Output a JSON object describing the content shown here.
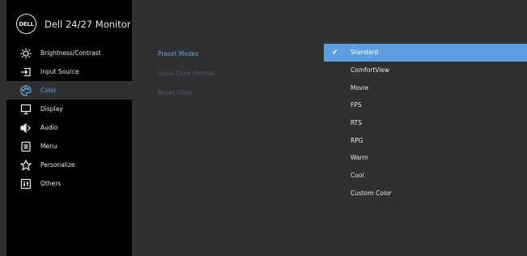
{
  "header": {
    "logo_text": "DELL",
    "title": "Dell 24/27 Monitor"
  },
  "sidebar": {
    "items": [
      {
        "label": "Brightness/Contrast",
        "icon": "brightness-icon"
      },
      {
        "label": "Input Source",
        "icon": "input-source-icon"
      },
      {
        "label": "Color",
        "icon": "color-palette-icon"
      },
      {
        "label": "Display",
        "icon": "display-icon"
      },
      {
        "label": "Audio",
        "icon": "speaker-icon"
      },
      {
        "label": "Menu",
        "icon": "menu-icon"
      },
      {
        "label": "Personalize",
        "icon": "star-icon"
      },
      {
        "label": "Others",
        "icon": "others-icon"
      }
    ],
    "active_index": 2
  },
  "submenu": {
    "items": [
      {
        "label": "Preset Modes",
        "state": "active"
      },
      {
        "label": "Input Color Format",
        "state": "disabled"
      },
      {
        "label": "Reset Color",
        "state": "disabled"
      }
    ]
  },
  "options": {
    "items": [
      "Standard",
      "ComfortView",
      "Movie",
      "FPS",
      "RTS",
      "RPG",
      "Warm",
      "Cool",
      "Custom Color"
    ],
    "selected_index": 0,
    "check_glyph": "✔"
  },
  "colors": {
    "sidebar_bg": "#000000",
    "panel_bg": "#2f3032",
    "accent": "#5b9ee1",
    "active_text": "#5ea3e0"
  }
}
